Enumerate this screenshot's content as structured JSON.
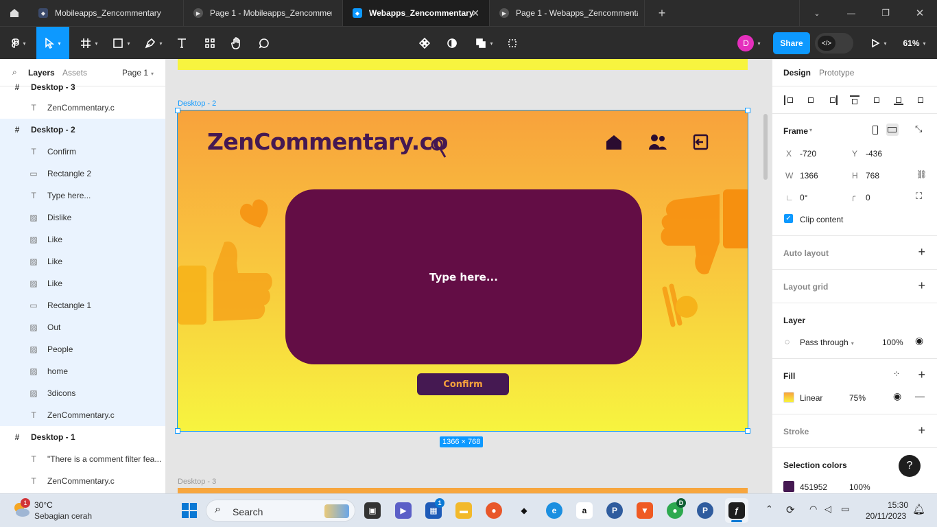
{
  "tabs": [
    {
      "label": "Mobileapps_Zencommentary"
    },
    {
      "label": "Page 1 - Mobileapps_Zencommentary"
    },
    {
      "label": "Webapps_Zencommentary"
    },
    {
      "label": "Page 1 - Webapps_Zencommentary"
    }
  ],
  "toolbar": {
    "avatar_initial": "D",
    "share_label": "Share",
    "zoom_label": "61%"
  },
  "leftpanel": {
    "tab_layers": "Layers",
    "tab_assets": "Assets",
    "page_selector": "Page 1",
    "layers": [
      {
        "label": "Desktop - 3"
      },
      {
        "label": "ZenCommentary.c"
      },
      {
        "label": "Desktop - 2"
      },
      {
        "label": "Confirm"
      },
      {
        "label": "Rectangle 2"
      },
      {
        "label": "Type here..."
      },
      {
        "label": "Dislike"
      },
      {
        "label": "Like"
      },
      {
        "label": "Like"
      },
      {
        "label": "Like"
      },
      {
        "label": "Rectangle 1"
      },
      {
        "label": "Out"
      },
      {
        "label": "People"
      },
      {
        "label": "home"
      },
      {
        "label": "3dicons"
      },
      {
        "label": "ZenCommentary.c"
      },
      {
        "label": "Desktop - 1"
      },
      {
        "label": "\"There is a comment filter fea..."
      },
      {
        "label": "ZenCommentary.c"
      }
    ]
  },
  "canvas": {
    "frame_label": "Desktop - 2",
    "frame3_label": "Desktop - 3",
    "size_badge": "1366 × 768",
    "brand": "ZenCommentary.co",
    "input_placeholder": "Type here...",
    "confirm_label": "Confirm"
  },
  "rightpanel": {
    "tab_design": "Design",
    "tab_prototype": "Prototype",
    "frame_title": "Frame",
    "x_label": "X",
    "x_value": "-720",
    "y_label": "Y",
    "y_value": "-436",
    "w_label": "W",
    "w_value": "1366",
    "h_label": "H",
    "h_value": "768",
    "rotation_value": "0°",
    "radius_value": "0",
    "clip_content": "Clip content",
    "auto_layout": "Auto layout",
    "layout_grid": "Layout grid",
    "layer_title": "Layer",
    "blend_mode": "Pass through",
    "layer_opacity": "100%",
    "fill_title": "Fill",
    "fill_type": "Linear",
    "fill_opacity": "75%",
    "stroke_title": "Stroke",
    "selection_colors_title": "Selection colors",
    "selection_color_hex": "451952",
    "selection_color_opacity": "100%",
    "help_label": "?"
  },
  "taskbar": {
    "weather_temp": "30°C",
    "weather_desc": "Sebagian cerah",
    "weather_badge": "1",
    "search_label": "Search",
    "store_badge": "1",
    "chrome_badge": "D",
    "time": "15:30",
    "date": "20/11/2023"
  },
  "colors": {
    "accent": "#0d99ff",
    "brand_purple": "#451952",
    "textbox_purple": "#630d45",
    "orange": "#f7a63e",
    "yellow": "#f7f43f"
  }
}
